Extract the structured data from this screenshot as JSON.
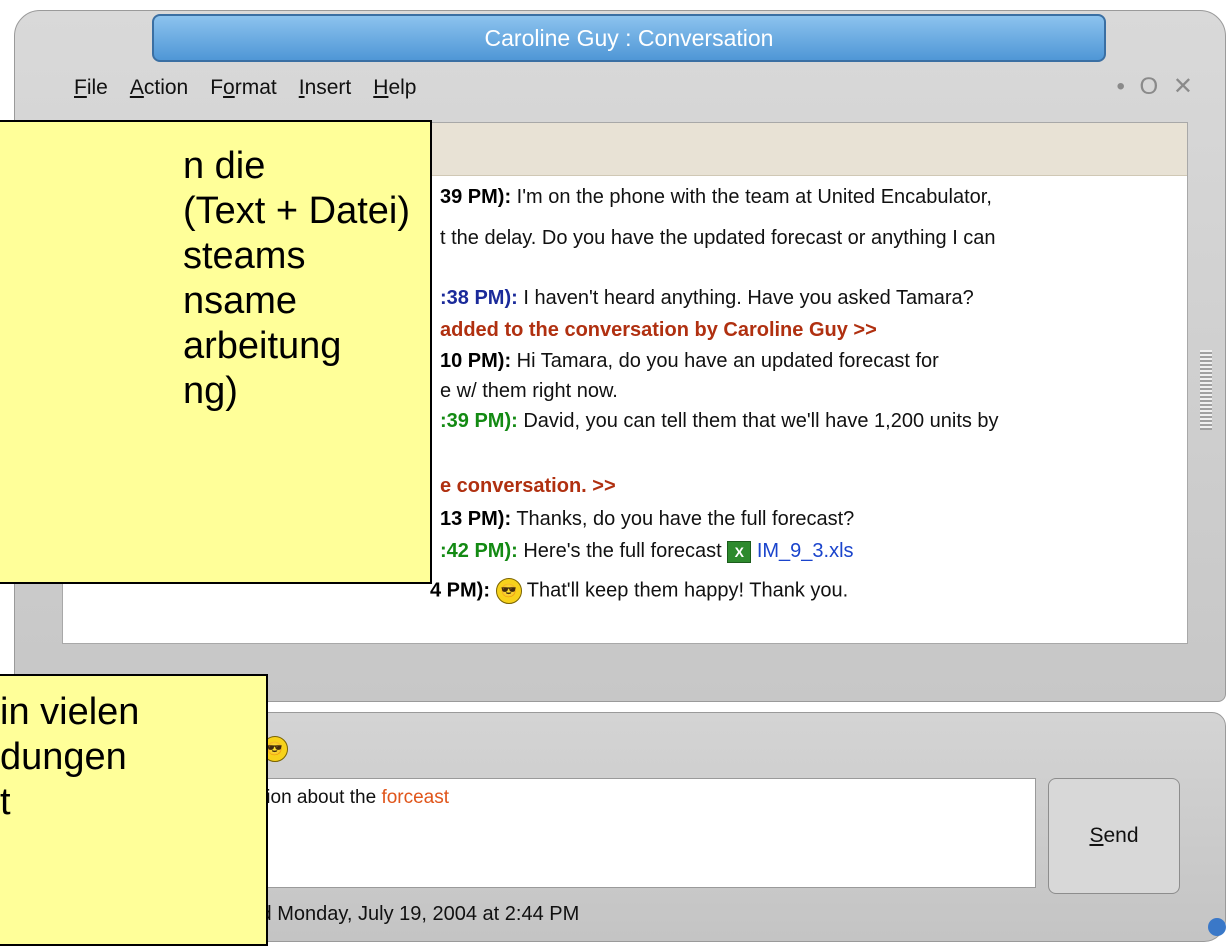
{
  "window": {
    "title": "Caroline Guy : Conversation"
  },
  "menu": [
    {
      "label": "File",
      "mnemonic": "F",
      "rest": "ile"
    },
    {
      "label": "Action",
      "mnemonic": "A",
      "rest": "ction"
    },
    {
      "label": "Format",
      "mnemonic": "o",
      "rest_before": "F",
      "rest_after": "rmat"
    },
    {
      "label": "Insert",
      "mnemonic": "I",
      "rest": "nsert"
    },
    {
      "label": "Help",
      "mnemonic": "H",
      "rest": "elp"
    }
  ],
  "window_controls": "• O ✕",
  "conversation": {
    "lines": [
      {
        "time": "39 PM):",
        "text": " I'm on the phone with the team at United Encabulator,",
        "style": "black"
      },
      {
        "time": "",
        "text": "t the delay.  Do you have the updated forecast or anything I can",
        "style": "none"
      },
      {
        "time": ":38 PM):",
        "text": " I haven't heard anything. Have you asked Tamara?",
        "style": "blue"
      },
      {
        "time": "",
        "text": "added to the conversation by Caroline Guy >>",
        "style": "sys"
      },
      {
        "time": "10 PM):",
        "text": " Hi Tamara, do you have an updated forecast for",
        "style": "black"
      },
      {
        "time": "",
        "text": "e w/ them right now.",
        "style": "none"
      },
      {
        "time": ":39 PM):",
        "text": " David, you can tell them that we'll have 1,200 units by",
        "style": "green"
      },
      {
        "time": "",
        "text": "e conversation. >>",
        "style": "sys"
      },
      {
        "time": "13 PM):",
        "text": " Thanks, do you have the full forecast?",
        "style": "black"
      },
      {
        "time": ":42 PM):",
        "text": " Here's the full forecast ",
        "style": "green",
        "file": "IM_9_3.xls"
      },
      {
        "time": "4 PM):",
        "text": " That'll keep them happy!  Thank you.",
        "style": "black",
        "emoticon": true
      }
    ]
  },
  "input": {
    "text_before": "tion about the ",
    "typo_word": "forceast"
  },
  "send_button": {
    "label": "Send",
    "mnemonic": "S",
    "rest": "end"
  },
  "status": {
    "text": "Last message received Monday, July 19, 2004 at 2:44 PM"
  },
  "callouts": {
    "upper": [
      "n die",
      " (Text + Datei)",
      "steams",
      "nsame",
      "arbeitung",
      "ng)"
    ],
    "lower": [
      "in vielen",
      "dungen",
      "t"
    ]
  },
  "colors": {
    "title_bar": "#4f97d6",
    "callout_bg": "#ffff99",
    "system_msg": "#b03010",
    "link": "#1a44cc"
  }
}
